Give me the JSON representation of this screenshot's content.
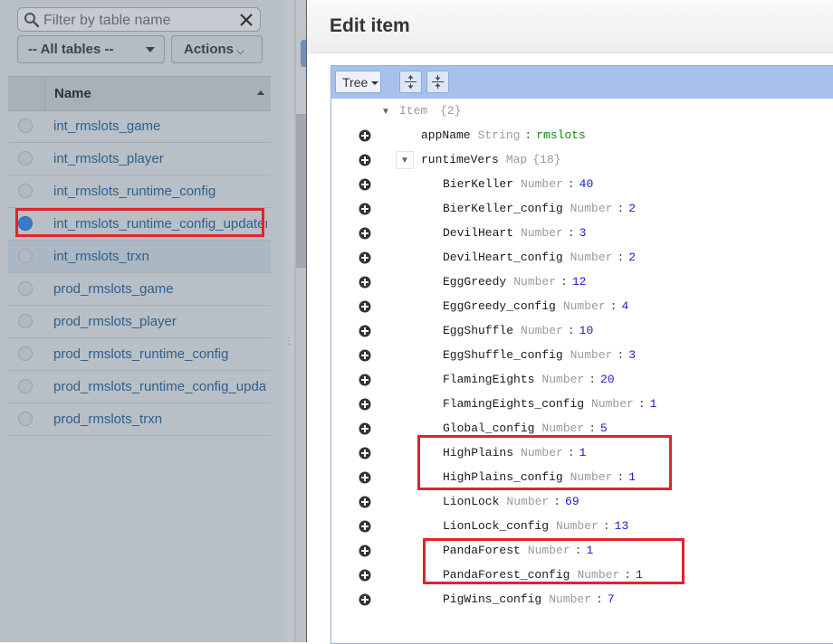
{
  "sidebar": {
    "filter_placeholder": "Filter by table name",
    "tables_select": "-- All tables --",
    "actions_label": "Actions",
    "actions_caret": "⌵",
    "column_header": "Name",
    "tables": [
      {
        "name": "int_rmslots_game",
        "selected": false
      },
      {
        "name": "int_rmslots_player",
        "selected": false
      },
      {
        "name": "int_rmslots_runtime_config",
        "selected": false
      },
      {
        "name": "int_rmslots_runtime_config_updater",
        "selected": true
      },
      {
        "name": "int_rmslots_trxn",
        "selected": false
      },
      {
        "name": "prod_rmslots_game",
        "selected": false
      },
      {
        "name": "prod_rmslots_player",
        "selected": false
      },
      {
        "name": "prod_rmslots_runtime_config",
        "selected": false
      },
      {
        "name": "prod_rmslots_runtime_config_updater",
        "selected": false
      },
      {
        "name": "prod_rmslots_trxn",
        "selected": false
      }
    ]
  },
  "dialog": {
    "title": "Edit item",
    "mode": "Tree",
    "root": {
      "label": "Item",
      "count": "{2}"
    },
    "app_field": {
      "key": "appName",
      "type": "String",
      "value": "rmslots"
    },
    "map_field": {
      "key": "runtimeVers",
      "type": "Map",
      "count": "{18}"
    },
    "entries": [
      {
        "key": "BierKeller",
        "type": "Number",
        "value": "40"
      },
      {
        "key": "BierKeller_config",
        "type": "Number",
        "value": "2"
      },
      {
        "key": "DevilHeart",
        "type": "Number",
        "value": "3"
      },
      {
        "key": "DevilHeart_config",
        "type": "Number",
        "value": "2"
      },
      {
        "key": "EggGreedy",
        "type": "Number",
        "value": "12"
      },
      {
        "key": "EggGreedy_config",
        "type": "Number",
        "value": "4"
      },
      {
        "key": "EggShuffle",
        "type": "Number",
        "value": "10"
      },
      {
        "key": "EggShuffle_config",
        "type": "Number",
        "value": "3"
      },
      {
        "key": "FlamingEights",
        "type": "Number",
        "value": "20"
      },
      {
        "key": "FlamingEights_config",
        "type": "Number",
        "value": "1"
      },
      {
        "key": "Global_config",
        "type": "Number",
        "value": "5"
      },
      {
        "key": "HighPlains",
        "type": "Number",
        "value": "1"
      },
      {
        "key": "HighPlains_config",
        "type": "Number",
        "value": "1"
      },
      {
        "key": "LionLock",
        "type": "Number",
        "value": "69"
      },
      {
        "key": "LionLock_config",
        "type": "Number",
        "value": "13"
      },
      {
        "key": "PandaForest",
        "type": "Number",
        "value": "1"
      },
      {
        "key": "PandaForest_config",
        "type": "Number",
        "value": "1"
      },
      {
        "key": "PigWins_config",
        "type": "Number",
        "value": "7"
      }
    ]
  },
  "colors": {
    "highlight": "#e0242b",
    "number": "#1a1acc",
    "string": "#118811",
    "link": "#2f5f8c"
  }
}
